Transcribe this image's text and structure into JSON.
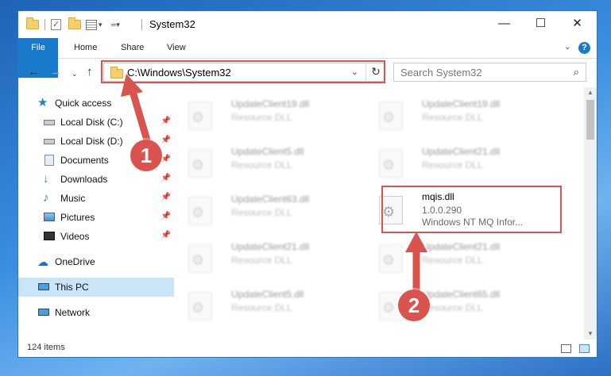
{
  "window": {
    "title": "System32",
    "controls": {
      "minimize": "—",
      "maximize": "☐",
      "close": "✕"
    }
  },
  "ribbon": {
    "tabs": [
      "File",
      "Home",
      "Share",
      "View"
    ],
    "help": "?"
  },
  "address": {
    "path": "C:\\Windows\\System32"
  },
  "search": {
    "placeholder": "Search System32"
  },
  "sidebar": {
    "items": [
      {
        "label": "Quick access",
        "icon": "star-icon"
      },
      {
        "label": "Local Disk (C:)",
        "icon": "drive-icon",
        "pinned": true
      },
      {
        "label": "Local Disk (D:)",
        "icon": "drive-icon",
        "pinned": true
      },
      {
        "label": "Documents",
        "icon": "documents-icon",
        "pinned": true
      },
      {
        "label": "Downloads",
        "icon": "download-icon",
        "pinned": true
      },
      {
        "label": "Music",
        "icon": "music-icon",
        "pinned": true
      },
      {
        "label": "Pictures",
        "icon": "pictures-icon",
        "pinned": true
      },
      {
        "label": "Videos",
        "icon": "videos-icon",
        "pinned": true
      },
      {
        "label": "OneDrive",
        "icon": "cloud-icon"
      },
      {
        "label": "This PC",
        "icon": "computer-icon",
        "selected": true
      },
      {
        "label": "Network",
        "icon": "network-icon"
      }
    ]
  },
  "files": {
    "left": [
      {
        "name": "UpdateClient19.dll",
        "desc": "Resource DLL"
      },
      {
        "name": "UpdateClient5.dll",
        "desc": "Resource DLL"
      },
      {
        "name": "UpdateClient63.dll",
        "desc": "Resource DLL"
      },
      {
        "name": "UpdateClient21.dll",
        "desc": "Resource DLL"
      },
      {
        "name": "UpdateClient5.dll",
        "desc": "Resource DLL"
      }
    ],
    "right": [
      {
        "name": "UpdateClient19.dll",
        "desc": "Resource DLL"
      },
      {
        "name": "UpdateClient21.dll",
        "desc": "Resource DLL"
      },
      {
        "name": "UpdateClient21.dll",
        "desc": "Resource DLL"
      },
      {
        "name": "UpdateClient65.dll",
        "desc": "Resource DLL"
      }
    ],
    "target": {
      "name": "mqis.dll",
      "version": "1.0.0.290",
      "desc": "Windows NT MQ Infor..."
    }
  },
  "status": {
    "count": "124 items"
  },
  "annotations": {
    "step1": "1",
    "step2": "2",
    "color": "#d9534f"
  }
}
